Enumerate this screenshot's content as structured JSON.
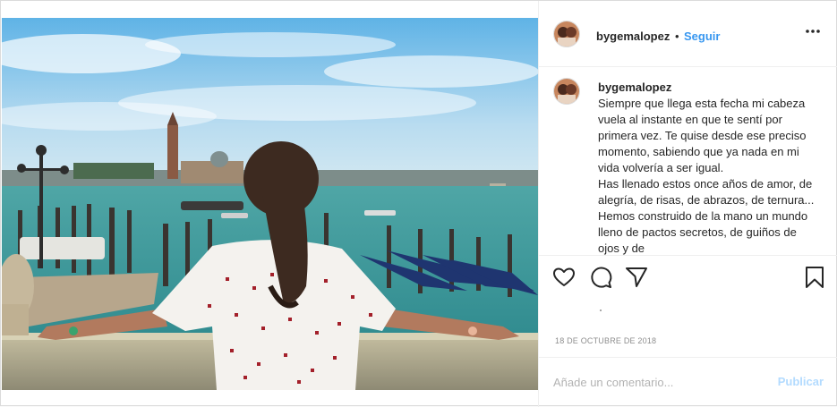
{
  "post": {
    "username": "bygemalopez",
    "separator": "•",
    "follow_label": "Seguir",
    "more_icon": "more-horizontal-icon",
    "image_alt": "photo-girl-looking-at-venice-lagoon"
  },
  "caption": {
    "username": "bygemalopez",
    "paragraphs": [
      "Siempre que llega esta fecha mi cabeza vuela al instante en que te sentí por primera vez. Te quise desde ese preciso momento, sabiendo que ya nada en mi vida volvería a ser igual.",
      "Has llenado estos once años de amor, de alegría, de risas, de abrazos, de ternura... Hemos construido de la mano un mundo lleno de pactos secretos, de guiños de ojos y de"
    ]
  },
  "actions": {
    "like_icon": "heart-icon",
    "comment_icon": "comment-icon",
    "share_icon": "paper-plane-icon",
    "save_icon": "bookmark-icon"
  },
  "date": "18 DE OCTUBRE DE 2018",
  "comment": {
    "placeholder": "Añade un comentario...",
    "publish_label": "Publicar"
  },
  "colors": {
    "link_blue": "#3897f0",
    "publish_disabled": "#b3dbff",
    "text": "#262626",
    "muted": "#8e8e8e"
  }
}
